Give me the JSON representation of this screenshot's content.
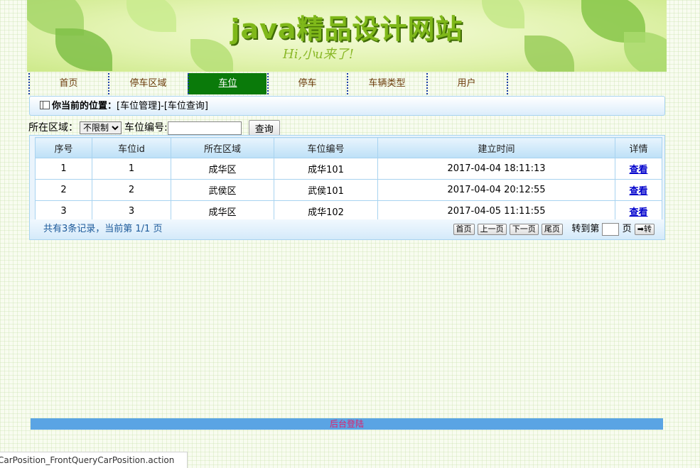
{
  "banner": {
    "title": "java精品设计网站",
    "subtitle": "Hi,小u来了!"
  },
  "nav": [
    {
      "label": "首页"
    },
    {
      "label": "停车区域"
    },
    {
      "label": "车位",
      "active": true
    },
    {
      "label": "停车"
    },
    {
      "label": "车辆类型"
    },
    {
      "label": "用户"
    }
  ],
  "breadcrumb": {
    "prefix": "你当前的位置：",
    "path": "[车位管理]-[车位查询]"
  },
  "search": {
    "area_label": "所在区域：",
    "area_selected": "不限制",
    "code_label": "车位编号:",
    "code_value": "",
    "submit_label": "查询"
  },
  "table": {
    "headers": [
      "序号",
      "车位id",
      "所在区域",
      "车位编号",
      "建立时间",
      "详情"
    ],
    "rows": [
      {
        "index": "1",
        "id": "1",
        "area": "成华区",
        "code": "成华101",
        "created": "2017-04-04 18:11:13",
        "link": "查看"
      },
      {
        "index": "2",
        "id": "2",
        "area": "武侯区",
        "code": "武侯101",
        "created": "2017-04-04 20:12:55",
        "link": "查看"
      },
      {
        "index": "3",
        "id": "3",
        "area": "成华区",
        "code": "成华102",
        "created": "2017-04-05 11:11:55",
        "link": "查看"
      }
    ]
  },
  "pager": {
    "summary": "共有3条记录，当前第 1/1 页",
    "first": "首页",
    "prev": "上一页",
    "next": "下一页",
    "last": "尾页",
    "goto_prefix": "转到第",
    "goto_suffix": "页",
    "go": "➡转"
  },
  "footer": {
    "admin_login": "后台登陆"
  },
  "statusbar": {
    "url": "CarPosition_FrontQueryCarPosition.action"
  },
  "colors": {
    "nav_active": "#0a7a0a",
    "footer_bar": "#5aa4e4",
    "footer_link": "#e0206a",
    "table_border": "#a8d3f0"
  }
}
